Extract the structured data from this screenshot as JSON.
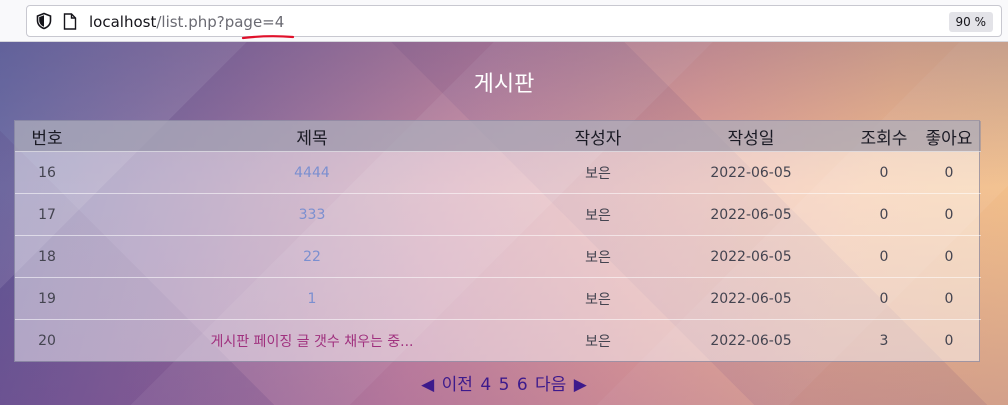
{
  "browser": {
    "url_host": "localhost",
    "url_path": "/list.php?page=4",
    "zoom": "90 %"
  },
  "page": {
    "title": "게시판"
  },
  "table": {
    "headers": [
      "번호",
      "제목",
      "작성자",
      "작성일",
      "조회수",
      "좋아요"
    ],
    "rows": [
      {
        "no": "16",
        "title": "4444",
        "author": "보은",
        "date": "2022-06-05",
        "views": "0",
        "likes": "0"
      },
      {
        "no": "17",
        "title": "333",
        "author": "보은",
        "date": "2022-06-05",
        "views": "0",
        "likes": "0"
      },
      {
        "no": "18",
        "title": "22",
        "author": "보은",
        "date": "2022-06-05",
        "views": "0",
        "likes": "0"
      },
      {
        "no": "19",
        "title": "1",
        "author": "보은",
        "date": "2022-06-05",
        "views": "0",
        "likes": "0"
      },
      {
        "no": "20",
        "title": "게시판 페이징 글 갯수 채우는 중...",
        "author": "보은",
        "date": "2022-06-05",
        "views": "3",
        "likes": "0"
      }
    ]
  },
  "pagination": {
    "prev_arrow": "◀",
    "prev_label": "이전",
    "pages": [
      "4",
      "5",
      "6"
    ],
    "next_label": "다음",
    "next_arrow": "▶"
  },
  "colors": {
    "link": "#7b8fd0",
    "visited_link": "#a0307e",
    "pager": "#3d1a8c",
    "annotation": "#e0102a"
  },
  "icons": {
    "shield": "shield-icon",
    "page": "page-icon"
  }
}
